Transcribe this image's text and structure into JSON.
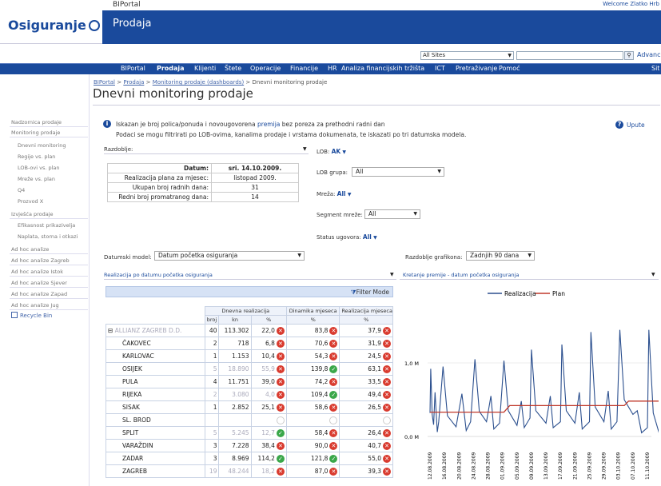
{
  "header": {
    "portal": "BIPortal",
    "welcome": "Welcome Zlatko Hrb",
    "site_title": "Prodaja",
    "logo": "Osiguranje"
  },
  "search": {
    "scope": "All Sites",
    "advanced": "Advanced"
  },
  "nav": [
    "BIPortal",
    "Prodaja",
    "Klijenti",
    "Štete",
    "Operacije",
    "Financije",
    "HR",
    "Analiza financijskih tržišta",
    "ICT",
    "Pretraživanje",
    "Pomoć"
  ],
  "nav_right": "Sit",
  "breadcrumb": {
    "l1": "BIPortal",
    "l2": "Prodaja",
    "l3": "Monitoring prodaje (dashboards)",
    "current": "Dnevni monitoring prodaje",
    "sep": " > "
  },
  "page_title": "Dnevni monitoring prodaje",
  "sidebar": [
    {
      "label": "Nadzornica prodaje",
      "sub": false
    },
    {
      "label": "Monitoring prodaje",
      "sub": false
    },
    {
      "label": "Dnevni monitoring",
      "sub": true
    },
    {
      "label": "Regije vs. plan",
      "sub": true
    },
    {
      "label": "LOB-ovi vs. plan",
      "sub": true
    },
    {
      "label": "Mreže vs. plan",
      "sub": true
    },
    {
      "label": "Q4",
      "sub": true
    },
    {
      "label": "Prozvod X",
      "sub": true
    },
    {
      "label": "Izvješća prodaje",
      "sub": false
    },
    {
      "label": "Efikasnost prikazivelja",
      "sub": true
    },
    {
      "label": "Naplata, storna i otkazi",
      "sub": true
    },
    {
      "label": "Ad hoc analize",
      "sub": false
    },
    {
      "label": "Ad hoc analize Zagreb",
      "sub": false
    },
    {
      "label": "Ad hoc analize Istok",
      "sub": false
    },
    {
      "label": "Ad hoc analize Sjever",
      "sub": false
    },
    {
      "label": "Ad hoc analize Zapad",
      "sub": false
    },
    {
      "label": "Ad hoc analize Jug",
      "sub": false
    }
  ],
  "recycle": "Recycle Bin",
  "info": {
    "line1a": "Iskazan je broj polica/ponuda i novougovorena ",
    "line1b": "premija",
    "line1c": " bez poreza za prethodni radni dan",
    "line2": "Podaci se mogu filtrirati po LOB-ovima, kanalima prodaje i vrstama dokumenata, te iskazati po tri datumska modela.",
    "help": "Upute"
  },
  "filters": {
    "razdoblje": "Razdoblje:",
    "lob": "LOB:",
    "lob_val": "AK",
    "lob_grupa": "LOB grupa:",
    "lob_grupa_val": "All",
    "mreza": "Mreža:",
    "mreza_val": "All",
    "segment": "Segment mreže:",
    "segment_val": "All",
    "status": "Status ugovora:",
    "status_val": "All",
    "datumski": "Datumski model:",
    "datumski_val": "Datum početka osiguranja",
    "razd_graf": "Razdoblje grafikona:",
    "razd_graf_val": "Zadnjih 90 dana"
  },
  "date_table": [
    [
      "Datum:",
      "sri. 14.10.2009."
    ],
    [
      "Realizacija plana za mjesec:",
      "listopad 2009."
    ],
    [
      "Ukupan broj radnih dana:",
      "31"
    ],
    [
      "Redni broj promatranog dana:",
      "14"
    ]
  ],
  "grid_title": "Realizacija po datumu početka osiguranja",
  "chart_title": "Kretanje premije - datum početka osiguranja",
  "filter_mode": "Filter Mode",
  "grid": {
    "h1": [
      "Dnevna realizacija",
      "Dinamika mjeseca",
      "Realizacija mjeseca"
    ],
    "h2": [
      "broj",
      "kn",
      "%",
      "%",
      "%"
    ],
    "rows": [
      {
        "name": "ALLIANZ ZAGREB D.D.",
        "broj": "40",
        "kn": "113.302",
        "pct": "22,0",
        "pi": "x",
        "dm": "83,8",
        "di": "x",
        "rm": "37,9",
        "ri": "x",
        "blur_name": true
      },
      {
        "name": "ČAKOVEC",
        "broj": "2",
        "kn": "718",
        "pct": "6,8",
        "pi": "x",
        "dm": "70,6",
        "di": "x",
        "rm": "31,9",
        "ri": "x"
      },
      {
        "name": "KARLOVAC",
        "broj": "1",
        "kn": "1.153",
        "pct": "10,4",
        "pi": "x",
        "dm": "54,3",
        "di": "x",
        "rm": "24,5",
        "ri": "x"
      },
      {
        "name": "OSIJEK",
        "broj": "5",
        "kn": "18.890",
        "pct": "55,9",
        "pi": "x",
        "dm": "139,8",
        "di": "ok",
        "rm": "63,1",
        "ri": "x",
        "blur": true
      },
      {
        "name": "PULA",
        "broj": "4",
        "kn": "11.751",
        "pct": "39,0",
        "pi": "x",
        "dm": "74,2",
        "di": "x",
        "rm": "33,5",
        "ri": "x"
      },
      {
        "name": "RIJEKA",
        "broj": "2",
        "kn": "3.080",
        "pct": "4,0",
        "pi": "x",
        "dm": "109,4",
        "di": "ok",
        "rm": "49,4",
        "ri": "x",
        "blur": true
      },
      {
        "name": "SISAK",
        "broj": "1",
        "kn": "2.852",
        "pct": "25,1",
        "pi": "x",
        "dm": "58,6",
        "di": "x",
        "rm": "26,5",
        "ri": "x"
      },
      {
        "name": "SL. BROD",
        "broj": "",
        "kn": "",
        "pct": "",
        "pi": "nd",
        "dm": "",
        "di": "nd",
        "rm": "",
        "ri": "nd"
      },
      {
        "name": "SPLIT",
        "broj": "5",
        "kn": "5.245",
        "pct": "12,7",
        "pi": "ok",
        "dm": "58,4",
        "di": "x",
        "rm": "26,4",
        "ri": "x",
        "blur": true
      },
      {
        "name": "VARAŽDIN",
        "broj": "3",
        "kn": "7.228",
        "pct": "38,4",
        "pi": "x",
        "dm": "90,0",
        "di": "x",
        "rm": "40,7",
        "ri": "x"
      },
      {
        "name": "ZADAR",
        "broj": "3",
        "kn": "8.969",
        "pct": "114,2",
        "pi": "ok",
        "dm": "121,8",
        "di": "ok",
        "rm": "55,0",
        "ri": "x"
      },
      {
        "name": "ZAGREB",
        "broj": "19",
        "kn": "48.244",
        "pct": "18,2",
        "pi": "x",
        "dm": "87,0",
        "di": "x",
        "rm": "39,3",
        "ri": "x",
        "blur": true
      }
    ]
  },
  "chart_data": {
    "type": "line",
    "title": "Kretanje premije - datum početka osiguranja",
    "legend": [
      "Realizacija",
      "Plan"
    ],
    "legend_position": "top",
    "colors": {
      "Realizacija": "#2b4f8e",
      "Plan": "#c0392b"
    },
    "yticks": [
      "1,0 M",
      "0,0 M"
    ],
    "ylim": [
      0,
      1.6
    ],
    "x": [
      "12.08.2009",
      "16.08.2009",
      "20.08.2009",
      "24.08.2009",
      "28.08.2009",
      "01.09.2009",
      "05.09.2009",
      "09.09.2009",
      "13.09.2009",
      "17.09.2009",
      "21.09.2009",
      "25.09.2009",
      "29.09.2009",
      "03.10.2009",
      "07.10.2009",
      "11.10.2009"
    ],
    "series": [
      {
        "name": "Realizacija",
        "points": [
          [
            0,
            0.32
          ],
          [
            0.05,
            0.92
          ],
          [
            0.15,
            0.3
          ],
          [
            0.25,
            0.16
          ],
          [
            0.35,
            0.6
          ],
          [
            0.5,
            0.06
          ],
          [
            0.6,
            0.2
          ],
          [
            0.9,
            0.95
          ],
          [
            1.2,
            0.28
          ],
          [
            1.8,
            0.13
          ],
          [
            2.2,
            0.58
          ],
          [
            2.5,
            0.08
          ],
          [
            2.8,
            0.2
          ],
          [
            3.1,
            1.05
          ],
          [
            3.4,
            0.34
          ],
          [
            3.9,
            0.2
          ],
          [
            4.2,
            0.55
          ],
          [
            4.4,
            0.1
          ],
          [
            4.8,
            0.18
          ],
          [
            5.1,
            1.03
          ],
          [
            5.4,
            0.35
          ],
          [
            6.0,
            0.15
          ],
          [
            6.3,
            0.48
          ],
          [
            6.5,
            0.12
          ],
          [
            6.9,
            0.25
          ],
          [
            7.0,
            1.18
          ],
          [
            7.3,
            0.35
          ],
          [
            8.0,
            0.18
          ],
          [
            8.3,
            0.55
          ],
          [
            8.5,
            0.12
          ],
          [
            9.0,
            0.2
          ],
          [
            9.1,
            1.25
          ],
          [
            9.4,
            0.35
          ],
          [
            10.0,
            0.18
          ],
          [
            10.3,
            0.6
          ],
          [
            10.5,
            0.1
          ],
          [
            11.0,
            0.2
          ],
          [
            11.1,
            1.42
          ],
          [
            11.4,
            0.4
          ],
          [
            12.0,
            0.2
          ],
          [
            12.3,
            0.62
          ],
          [
            12.5,
            0.1
          ],
          [
            12.9,
            0.2
          ],
          [
            13.1,
            1.45
          ],
          [
            13.4,
            0.5
          ],
          [
            14.0,
            0.3
          ],
          [
            14.3,
            0.35
          ],
          [
            14.6,
            0.05
          ],
          [
            15.0,
            0.12
          ],
          [
            15.1,
            1.45
          ],
          [
            15.4,
            0.32
          ],
          [
            15.8,
            0.05
          ]
        ]
      },
      {
        "name": "Plan",
        "points": [
          [
            0,
            0.33
          ],
          [
            5.1,
            0.33
          ],
          [
            5.5,
            0.42
          ],
          [
            13.4,
            0.42
          ],
          [
            13.7,
            0.48
          ],
          [
            15.9,
            0.48
          ]
        ]
      }
    ]
  }
}
